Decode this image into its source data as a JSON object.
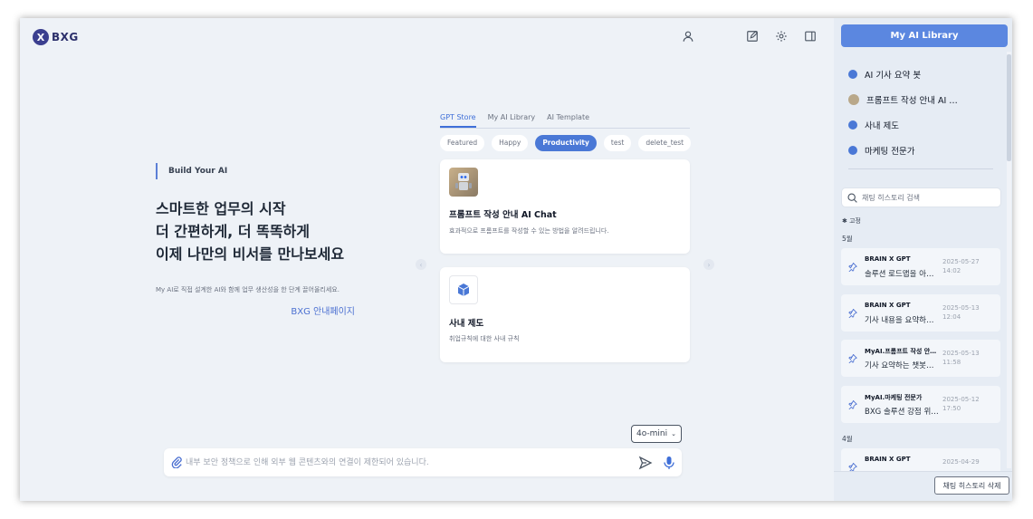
{
  "header": {
    "logo_letter": "X",
    "logo_text": "BXG",
    "icons": [
      "user-icon",
      "edit-icon",
      "gear-icon",
      "panel-icon"
    ]
  },
  "hero": {
    "tag": "Build Your AI",
    "title_lines": [
      "스마트한 업무의 시작",
      "더 간편하게, 더 똑똑하게",
      "이제 나만의 비서를 만나보세요"
    ],
    "description": "My AI로 직접 설계한 AI와 함께 업무 생산성을 한 단계 끌어올리세요.",
    "link": "BXG 안내페이지"
  },
  "tabs": [
    {
      "label": "GPT Store",
      "active": true
    },
    {
      "label": "My AI Library",
      "active": false
    },
    {
      "label": "AI Template",
      "active": false
    }
  ],
  "chips": [
    {
      "label": "Featured",
      "active": false
    },
    {
      "label": "Happy",
      "active": false
    },
    {
      "label": "Productivity",
      "active": true
    },
    {
      "label": "test",
      "active": false
    },
    {
      "label": "delete_test",
      "active": false
    }
  ],
  "cards": [
    {
      "title": "프롬프트 작성 안내 AI Chat",
      "description": "효과적으로 프롬프트를 작성할 수 있는 방법을 알려드립니다.",
      "icon": "robot-image"
    },
    {
      "title": "사내 제도",
      "description": "취업규칙에 대한 사내 규칙",
      "icon": "cube-icon"
    }
  ],
  "input": {
    "model": "4o-mini",
    "placeholder": "내부 보안 정책으로 인해 외부 웹 콘텐츠와의 연결이 제한되어 있습니다."
  },
  "sidebar": {
    "library_button": "My AI Library",
    "library_items": [
      {
        "label": "AI 기사 요약 봇",
        "icon": "dot"
      },
      {
        "label": "프롬프트 작성 안내 AI …",
        "icon": "avatar"
      },
      {
        "label": "사내 제도",
        "icon": "dot"
      },
      {
        "label": "마케팅 전문가",
        "icon": "dot"
      }
    ],
    "search_placeholder": "채팅 히스토리 검색",
    "pinned_label": "✱ 고정",
    "groups": [
      {
        "month": "5월",
        "items": [
          {
            "who": "BRAIN X GPT",
            "msg": "솔루션 로드맵을 아…",
            "date": "2025-05-27",
            "time": "14:02"
          },
          {
            "who": "BRAIN X GPT",
            "msg": "기사 내용을 요약하…",
            "date": "2025-05-13",
            "time": "12:04"
          },
          {
            "who": "MyAI.프롬프트 작성 안…",
            "msg": "기사 요약하는 챗봇…",
            "date": "2025-05-13",
            "time": "11:58"
          },
          {
            "who": "MyAI.마케팅 전문가",
            "msg": "BXG 솔루션 강점 위…",
            "date": "2025-05-12",
            "time": "17:50"
          }
        ]
      },
      {
        "month": "4월",
        "items": [
          {
            "who": "BRAIN X GPT",
            "msg": "",
            "date": "2025-04-29",
            "time": ""
          }
        ]
      }
    ],
    "delete_button": "채팅 히스토리 삭제"
  }
}
